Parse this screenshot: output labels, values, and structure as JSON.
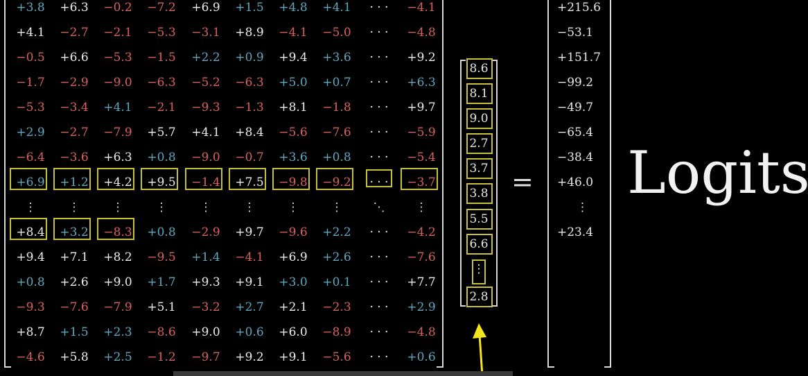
{
  "matrix": {
    "rows": [
      [
        "+3.8",
        "+6.3",
        "−0.2",
        "−7.2",
        "+6.9",
        "+1.5",
        "+4.8",
        "+4.1",
        "· · ·",
        "−4.1"
      ],
      [
        "+4.1",
        "−2.7",
        "−2.1",
        "−5.3",
        "−3.1",
        "+8.9",
        "−4.1",
        "−5.0",
        "· · ·",
        "−4.8"
      ],
      [
        "−0.5",
        "+6.6",
        "−5.3",
        "−1.5",
        "+2.2",
        "+0.9",
        "+9.4",
        "+3.6",
        "· · ·",
        "+9.2"
      ],
      [
        "−1.7",
        "−2.9",
        "−9.0",
        "−6.3",
        "−5.2",
        "−6.3",
        "+5.0",
        "+0.7",
        "· · ·",
        "+6.3"
      ],
      [
        "−5.3",
        "−3.4",
        "+4.1",
        "−2.1",
        "−9.3",
        "−1.3",
        "+8.1",
        "−1.8",
        "· · ·",
        "+9.7"
      ],
      [
        "+2.9",
        "−2.7",
        "−7.9",
        "+5.7",
        "+4.1",
        "+8.4",
        "−5.6",
        "−7.6",
        "· · ·",
        "−5.9"
      ],
      [
        "−6.4",
        "−3.6",
        "+6.3",
        "+0.8",
        "−9.0",
        "−0.7",
        "+3.6",
        "+0.8",
        "· · ·",
        "−5.4"
      ],
      [
        "+6.9",
        "+1.2",
        "+4.2",
        "+9.5",
        "−1.4",
        "+7.5",
        "−9.8",
        "−9.2",
        "· · ·",
        "−3.7"
      ],
      [
        "⋮",
        "⋮",
        "⋮",
        "⋮",
        "⋮",
        "⋮",
        "⋮",
        "⋮",
        "⋱",
        "⋮"
      ],
      [
        "+8.4",
        "+3.2",
        "−8.3",
        "+0.8",
        "−2.9",
        "+9.7",
        "−9.6",
        "+2.2",
        "· · ·",
        "−4.2"
      ],
      [
        "+9.4",
        "+7.1",
        "+8.2",
        "−9.5",
        "+1.4",
        "−4.1",
        "+6.9",
        "+2.6",
        "· · ·",
        "−7.6"
      ],
      [
        "+0.8",
        "+2.6",
        "+9.0",
        "+1.7",
        "+9.3",
        "+9.1",
        "+3.0",
        "+0.1",
        "· · ·",
        "+7.7"
      ],
      [
        "−9.3",
        "−7.6",
        "−7.9",
        "+5.1",
        "−3.2",
        "+2.7",
        "+2.1",
        "−2.3",
        "· · ·",
        "+2.9"
      ],
      [
        "+8.7",
        "+1.5",
        "+2.3",
        "−8.6",
        "+9.0",
        "+0.6",
        "+6.0",
        "−8.9",
        "· · ·",
        "−4.8"
      ],
      [
        "−4.6",
        "+5.8",
        "+2.5",
        "−1.2",
        "−9.7",
        "+9.2",
        "+9.1",
        "−5.6",
        "· · ·",
        "+0.6"
      ]
    ],
    "colors": [
      [
        "b",
        "w",
        "r",
        "r",
        "w",
        "b",
        "b",
        "b",
        "w",
        "r"
      ],
      [
        "w",
        "r",
        "r",
        "r",
        "r",
        "w",
        "r",
        "r",
        "w",
        "r"
      ],
      [
        "r",
        "w",
        "r",
        "r",
        "b",
        "b",
        "w",
        "b",
        "w",
        "w"
      ],
      [
        "r",
        "r",
        "r",
        "r",
        "r",
        "r",
        "b",
        "b",
        "w",
        "b"
      ],
      [
        "r",
        "r",
        "b",
        "r",
        "r",
        "r",
        "w",
        "r",
        "w",
        "w"
      ],
      [
        "b",
        "r",
        "r",
        "w",
        "w",
        "w",
        "r",
        "r",
        "w",
        "r"
      ],
      [
        "r",
        "r",
        "w",
        "b",
        "r",
        "r",
        "b",
        "b",
        "w",
        "r"
      ],
      [
        "b",
        "b",
        "w",
        "w",
        "r",
        "w",
        "r",
        "r",
        "w",
        "r"
      ],
      [
        "w",
        "w",
        "w",
        "w",
        "w",
        "w",
        "w",
        "w",
        "w",
        "w"
      ],
      [
        "w",
        "b",
        "r",
        "b",
        "r",
        "w",
        "r",
        "b",
        "w",
        "r"
      ],
      [
        "w",
        "w",
        "w",
        "r",
        "b",
        "r",
        "w",
        "b",
        "w",
        "r"
      ],
      [
        "b",
        "w",
        "w",
        "b",
        "w",
        "w",
        "b",
        "b",
        "w",
        "w"
      ],
      [
        "r",
        "r",
        "r",
        "w",
        "r",
        "b",
        "w",
        "r",
        "w",
        "b"
      ],
      [
        "w",
        "b",
        "b",
        "r",
        "w",
        "b",
        "w",
        "r",
        "w",
        "r"
      ],
      [
        "r",
        "w",
        "b",
        "r",
        "r",
        "w",
        "w",
        "r",
        "w",
        "b"
      ]
    ]
  },
  "vector": [
    "8.6",
    "8.1",
    "9.0",
    "2.7",
    "3.7",
    "3.8",
    "5.5",
    "6.6",
    "⋮",
    "2.8"
  ],
  "equals": "=",
  "result": [
    "+215.6",
    "−53.1",
    "+151.7",
    "−99.2",
    "−49.7",
    "−65.4",
    "−38.4",
    "+46.0",
    "⋮",
    "+23.4"
  ],
  "label": "Logits",
  "colors": {
    "red": "#d9625e",
    "blue": "#5fa8c0",
    "white": "#eeeeee",
    "highlight": "#c8c23a",
    "arrow": "#f3e61c"
  }
}
